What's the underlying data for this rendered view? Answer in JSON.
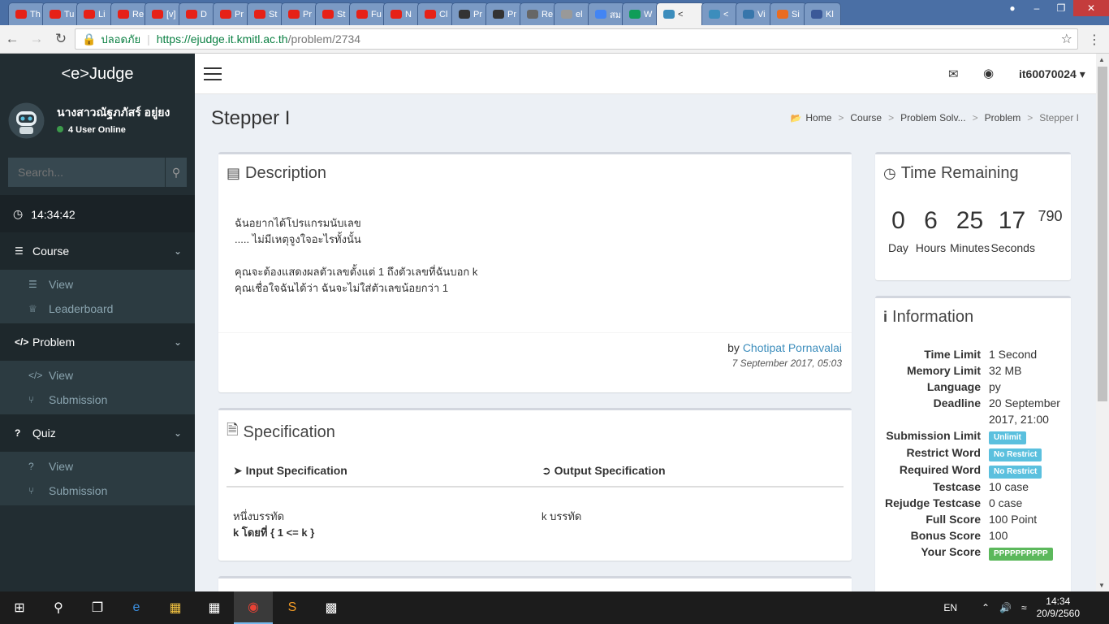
{
  "browser": {
    "tabs": [
      "Th",
      "Tu",
      "Li",
      "Re",
      "[v]",
      "D",
      "Pr",
      "St",
      "Pr",
      "St",
      "Fu",
      "N",
      "Cl",
      "Pr",
      "Pr",
      "Re",
      "el",
      "สม",
      "W",
      "<",
      "<",
      "Vi",
      "Si",
      "Kl"
    ],
    "secure_label": "ปลอดภัย",
    "url_host": "https://ejudge.it.kmitl.ac.th",
    "url_path": "/problem/2734"
  },
  "sidebar": {
    "logo": "<e>Judge",
    "user_name": "นางสาวณัฐภภัสร์ อยู่ยง",
    "online": "4 User Online",
    "search_placeholder": "Search...",
    "clock": "14:34:42",
    "menus": [
      {
        "label": "Course",
        "icon": "list-icon",
        "items": [
          {
            "label": "View",
            "icon": "list-icon"
          },
          {
            "label": "Leaderboard",
            "icon": "trophy-icon"
          }
        ]
      },
      {
        "label": "Problem",
        "icon": "code-icon",
        "items": [
          {
            "label": "View",
            "icon": "code-icon"
          },
          {
            "label": "Submission",
            "icon": "branch-icon"
          }
        ]
      },
      {
        "label": "Quiz",
        "icon": "question-icon",
        "items": [
          {
            "label": "View",
            "icon": "question-icon"
          },
          {
            "label": "Submission",
            "icon": "branch-icon"
          }
        ]
      }
    ]
  },
  "topnav": {
    "username": "it60070024"
  },
  "page": {
    "title": "Stepper I",
    "breadcrumb": [
      "Home",
      "Course",
      "Problem Solv...",
      "Problem",
      "Stepper I"
    ]
  },
  "description": {
    "title": "Description",
    "lines": [
      "ฉันอยากได้โปรแกรมนับเลข",
      "..... ไม่มีเหตุจูงใจอะไรทั้งนั้น",
      "",
      "คุณจะต้องแสดงผลตัวเลขตั้งแต่ 1 ถึงตัวเลขที่ฉันบอก k",
      "คุณเชื่อใจฉันได้ว่า ฉันจะไม่ใส่ตัวเลขน้อยกว่า 1"
    ],
    "by_label": "by",
    "author": "Chotipat Pornavalai",
    "date": "7 September 2017, 05:03"
  },
  "specification": {
    "title": "Specification",
    "input_head": "Input Specification",
    "output_head": "Output Specification",
    "input_line1": "หนึ่งบรรทัด",
    "input_line2": "k โดยที่ { 1 <= k }",
    "output_line1": "k บรรทัด"
  },
  "timer": {
    "title": "Time Remaining",
    "day": "0",
    "hours": "6",
    "minutes": "25",
    "seconds": "17",
    "ms": "790",
    "day_label": "Day",
    "hours_label": "Hours",
    "minutes_label": "Minutes",
    "seconds_label": "Seconds"
  },
  "information": {
    "title": "Information",
    "rows": [
      {
        "key": "Time Limit",
        "value": "1 Second"
      },
      {
        "key": "Memory Limit",
        "value": "32 MB"
      },
      {
        "key": "Language",
        "value": "py"
      },
      {
        "key": "Deadline",
        "value": "20 September 2017, 21:00"
      },
      {
        "key": "Submission Limit",
        "badge": "Unlimit",
        "color": "#5bc0de"
      },
      {
        "key": "Restrict Word",
        "badge": "No Restrict",
        "color": "#5bc0de"
      },
      {
        "key": "Required Word",
        "badge": "No Restrict",
        "color": "#5bc0de"
      },
      {
        "key": "Testcase",
        "value": "10 case"
      },
      {
        "key": "Rejudge Testcase",
        "value": "0 case"
      },
      {
        "key": "Full Score",
        "value": "100 Point"
      },
      {
        "key": "Bonus Score",
        "value": "100"
      },
      {
        "key": "Your Score",
        "badge": "PPPPPPPPPP",
        "color": "#5cb85c"
      }
    ]
  },
  "taskbar": {
    "lang": "EN",
    "time": "14:34",
    "date": "20/9/2560"
  }
}
